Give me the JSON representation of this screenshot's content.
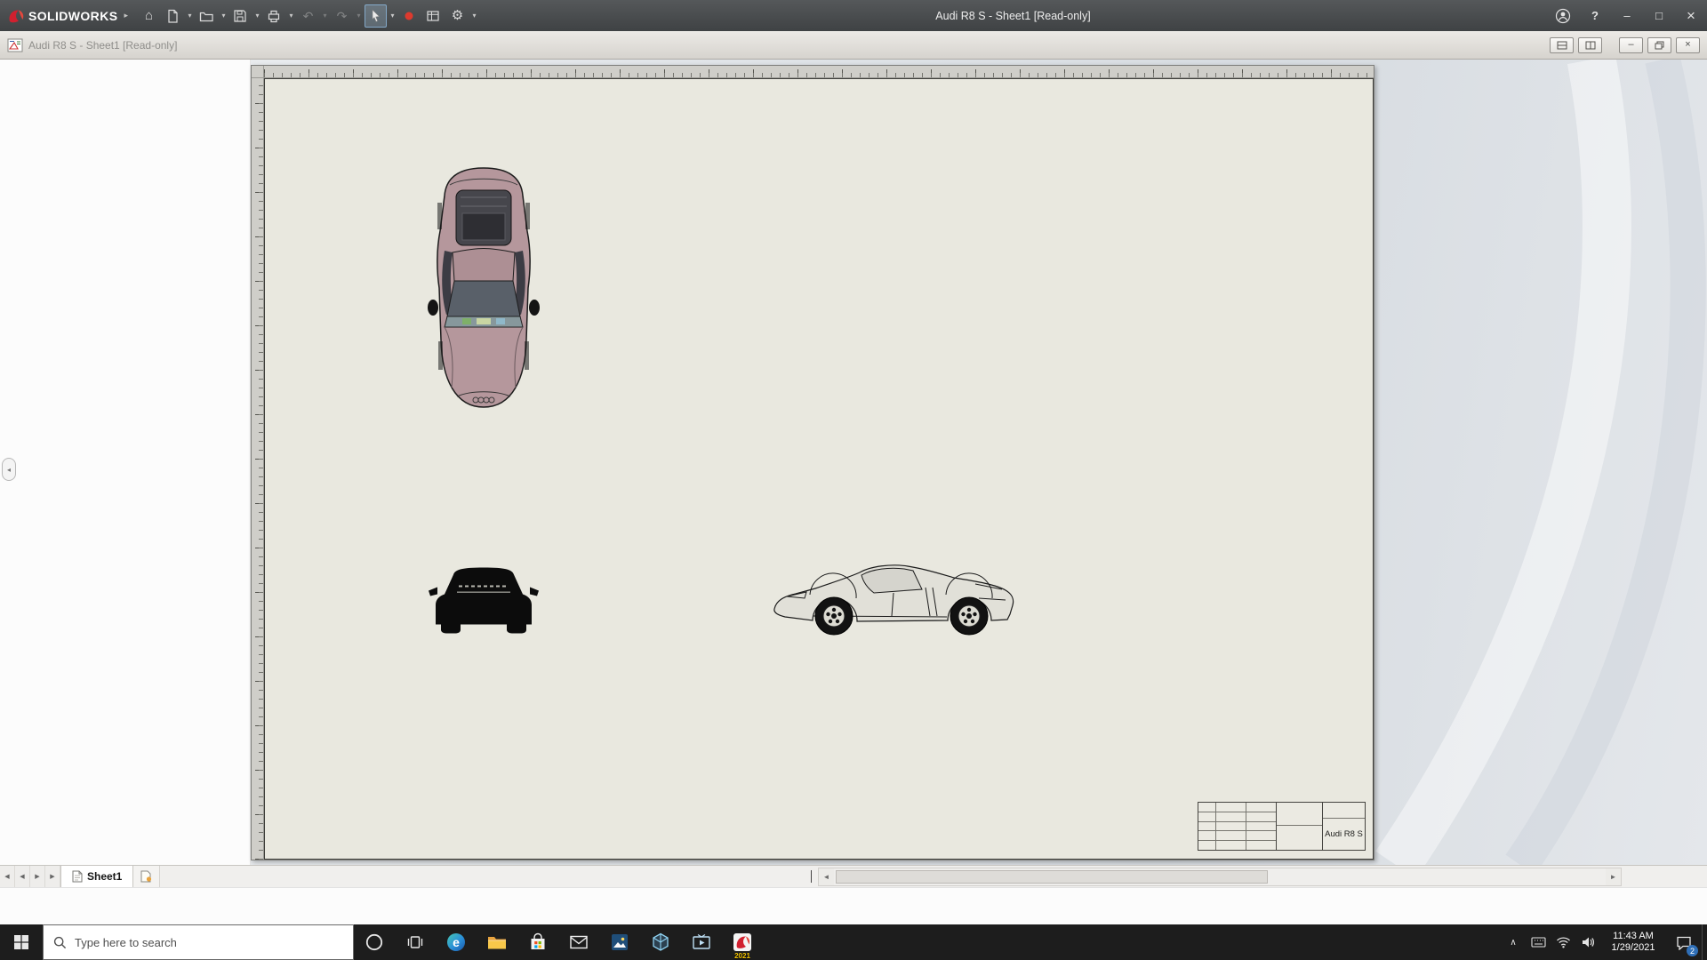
{
  "app": {
    "brand": "SOLIDWORKS",
    "title": "Audi R8 S - Sheet1 [Read-only]",
    "doc_title": "Audi R8 S - Sheet1 [Read-only]"
  },
  "toolbar_icons": [
    "home",
    "new-document",
    "open",
    "save",
    "print",
    "undo",
    "redo",
    "select-arrow",
    "record-macro",
    "sheet-properties",
    "options-gear"
  ],
  "glyphs": {
    "brand_arrow": "▸",
    "caret": "▾",
    "home": "⌂",
    "undo": "↶",
    "redo": "↷",
    "gear": "⚙",
    "help": "?",
    "minimize": "–",
    "maximize": "□",
    "close": "×",
    "collapse_left": "◂",
    "nav_prev": "◀",
    "nav_next": "▶",
    "scroll_left": "◄",
    "scroll_right": "►",
    "tray_chevron": "∧",
    "edge_e": "e"
  },
  "sheet": {
    "tab_label": "Sheet1",
    "title_block_part": "Audi R8 S"
  },
  "taskbar": {
    "search_text": "Type here to search",
    "time": "11:43 AM",
    "date": "1/29/2021",
    "solidworks_year": "2021",
    "notification_count": "2"
  },
  "colors": {
    "brand_red": "#d1202f",
    "titlebar_bg": "#4a4c4e",
    "paper": "#e9e8df",
    "taskbar_bg": "#1d1d1d",
    "badge_blue": "#2f6fb7"
  }
}
